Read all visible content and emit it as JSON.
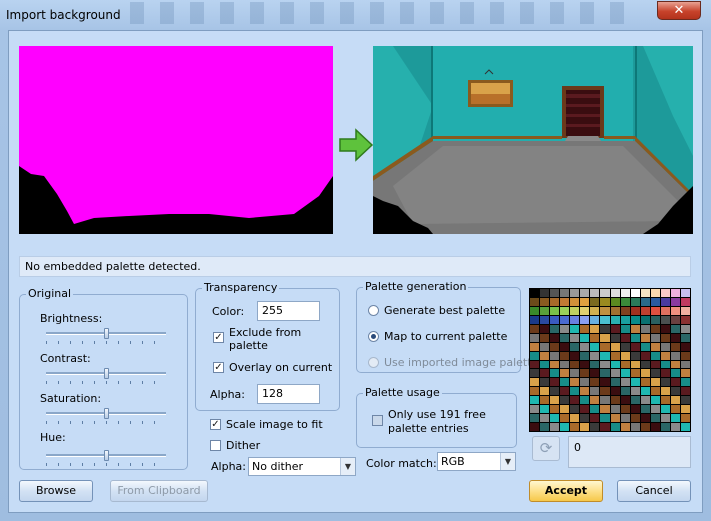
{
  "window": {
    "title": "Import background",
    "close_glyph": "✕"
  },
  "status": {
    "message": "No embedded palette detected."
  },
  "original": {
    "group_label": "Original",
    "brightness_label": "Brightness:",
    "brightness_level": 0.5,
    "contrast_label": "Contrast:",
    "contrast_level": 0.5,
    "saturation_label": "Saturation:",
    "saturation_level": 0.5,
    "hue_label": "Hue:",
    "hue_level": 0.5
  },
  "transparency": {
    "group_label": "Transparency",
    "color_label": "Color:",
    "color_value": "255",
    "exclude_label_line1": "Exclude from",
    "exclude_label_line2": "palette",
    "exclude_checked": true,
    "overlay_label": "Overlay on current",
    "overlay_checked": true,
    "alpha_label": "Alpha:",
    "alpha_value": "128"
  },
  "options": {
    "scale_label": "Scale image to fit",
    "scale_checked": true,
    "dither_label": "Dither",
    "dither_checked": false,
    "alpha_label": "Alpha:",
    "alpha_select": "No dither"
  },
  "palette_generation": {
    "group_label": "Palette generation",
    "option1": "Generate best palette",
    "option2": "Map to current palette",
    "option3": "Use imported image palette",
    "selected": 2
  },
  "palette_usage": {
    "group_label": "Palette usage",
    "only_use_line1": "Only use 191 free",
    "only_use_line2": "palette entries",
    "only_use_checked": false
  },
  "color_match": {
    "label": "Color match:",
    "value": "RGB"
  },
  "palette_panel": {
    "count": "0",
    "refresh_icon": "refresh-icon"
  },
  "buttons": {
    "browse": "Browse",
    "from_clipboard": "From Clipboard",
    "accept": "Accept",
    "cancel": "Cancel"
  },
  "colors": {
    "magenta_bg": "#ff00ff",
    "accent_arrow": "#5ec23c",
    "room_wall": "#1fb7b0",
    "accept_button": "#f6c84a"
  }
}
